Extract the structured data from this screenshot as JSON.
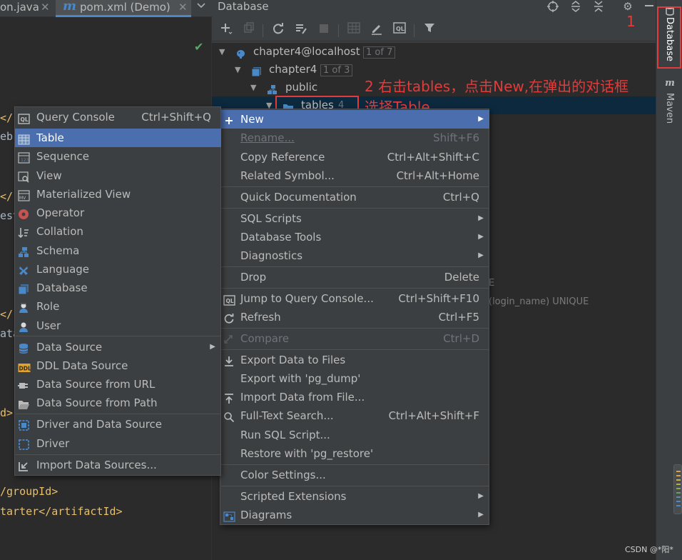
{
  "editor": {
    "tabs": [
      {
        "label": "on.java",
        "close": "✕"
      },
      {
        "label": "pom.xml (Demo)",
        "close": "✕",
        "icon": "maven-m-icon"
      }
    ],
    "code_fragments": [
      "</",
      "eb",
      "</",
      "est",
      "</",
      "ata",
      "d>",
      "/groupId>",
      "tarter</artifactId>"
    ]
  },
  "db_panel": {
    "title": "Database",
    "tree": [
      {
        "label": "chapter4@localhost",
        "badge": "1 of 7"
      },
      {
        "label": "chapter4",
        "badge": "1 of 3"
      },
      {
        "label": "public"
      },
      {
        "label": "tables",
        "count": "4"
      }
    ],
    "background_fragments": [
      "E",
      "(login_name) UNIQUE"
    ]
  },
  "annotations": {
    "step1": "1",
    "step2_line1": "2 右击tables，点击New,在弹出的对话框",
    "step2_line2": "选择Table"
  },
  "right_stripe": {
    "database_tab": "Database",
    "maven_tab": "Maven"
  },
  "context_menu": {
    "items": [
      {
        "label": "New",
        "submenu": true,
        "highlighted": true
      },
      {
        "label": "Rename...",
        "shortcut": "Shift+F6",
        "disabled": true
      },
      {
        "label": "Copy Reference",
        "shortcut": "Ctrl+Alt+Shift+C"
      },
      {
        "label": "Related Symbol...",
        "shortcut": "Ctrl+Alt+Home"
      },
      {
        "label": "Quick Documentation",
        "shortcut": "Ctrl+Q"
      },
      {
        "label": "SQL Scripts",
        "submenu": true
      },
      {
        "label": "Database Tools",
        "submenu": true
      },
      {
        "label": "Diagnostics",
        "submenu": true
      },
      {
        "label": "Drop",
        "shortcut": "Delete"
      },
      {
        "label": "Jump to Query Console...",
        "shortcut": "Ctrl+Shift+F10"
      },
      {
        "label": "Refresh",
        "shortcut": "Ctrl+F5"
      },
      {
        "label": "Compare",
        "shortcut": "Ctrl+D",
        "disabled": true
      },
      {
        "label": "Export Data to Files"
      },
      {
        "label": "Export with 'pg_dump'"
      },
      {
        "label": "Import Data from File..."
      },
      {
        "label": "Full-Text Search...",
        "shortcut": "Ctrl+Alt+Shift+F"
      },
      {
        "label": "Run SQL Script..."
      },
      {
        "label": "Restore with 'pg_restore'"
      },
      {
        "label": "Color Settings..."
      },
      {
        "label": "Scripted Extensions",
        "submenu": true
      },
      {
        "label": "Diagrams",
        "submenu": true
      }
    ]
  },
  "new_submenu": {
    "items": [
      {
        "label": "Query Console",
        "shortcut": "Ctrl+Shift+Q"
      },
      {
        "label": "Table",
        "highlighted": true
      },
      {
        "label": "Sequence"
      },
      {
        "label": "View"
      },
      {
        "label": "Materialized View"
      },
      {
        "label": "Operator"
      },
      {
        "label": "Collation"
      },
      {
        "label": "Schema"
      },
      {
        "label": "Language"
      },
      {
        "label": "Database"
      },
      {
        "label": "Role"
      },
      {
        "label": "User"
      },
      {
        "label": "Data Source",
        "submenu": true
      },
      {
        "label": "DDL Data Source"
      },
      {
        "label": "Data Source from URL"
      },
      {
        "label": "Data Source from Path"
      },
      {
        "label": "Driver and Data Source"
      },
      {
        "label": "Driver"
      },
      {
        "label": "Import Data Sources..."
      }
    ]
  },
  "watermark": "CSDN @*阳*",
  "colors": {
    "highlight": "#4b6eaf",
    "annotation_red": "#e23b3b",
    "selection": "#0d293e"
  }
}
